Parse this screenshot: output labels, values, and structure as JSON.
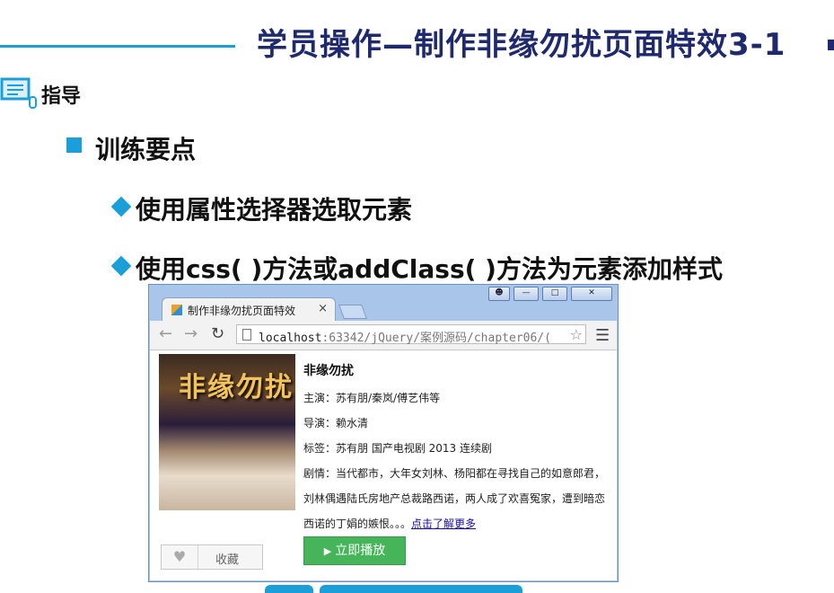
{
  "slide": {
    "title": "学员操作—制作非缘勿扰页面特效3-1",
    "guide_label": "指导",
    "point_title": "训练要点",
    "sub_points": [
      "使用属性选择器选取元素",
      "使用css( )方法或addClass( )方法为元素添加样式"
    ]
  },
  "browser": {
    "tab_title": "制作非缘勿扰页面特效",
    "tab_close": "×",
    "url_host": "localhost",
    "url_rest": ":63342/jQuery/案例源码/chapter06/(",
    "window_buttons": [
      "user",
      "minimize",
      "maximize",
      "close"
    ]
  },
  "movie": {
    "poster_title": "非缘勿扰",
    "title": "非缘勿扰",
    "cast": "主演：苏有朋/秦岚/傅艺伟等",
    "director": "导演：赖水清",
    "tags": "标签：苏有朋 国产电视剧 2013 连续剧",
    "plot_line1": "剧情：当代都市，大年女刘林、杨阳都在寻找自己的如意郎君，",
    "plot_line2": "刘林偶遇陆氏房地产总裁路西诺，两人成了欢喜冤家，遭到暗恋",
    "plot_line3": "西诺的丁娟的嫉恨。。。",
    "more_link": "点击了解更多",
    "favorite_label": "收藏",
    "play_label": "立即播放"
  },
  "colors": {
    "accent": "#1a9fd9",
    "title": "#1f2a6e",
    "play": "#46b55a"
  }
}
